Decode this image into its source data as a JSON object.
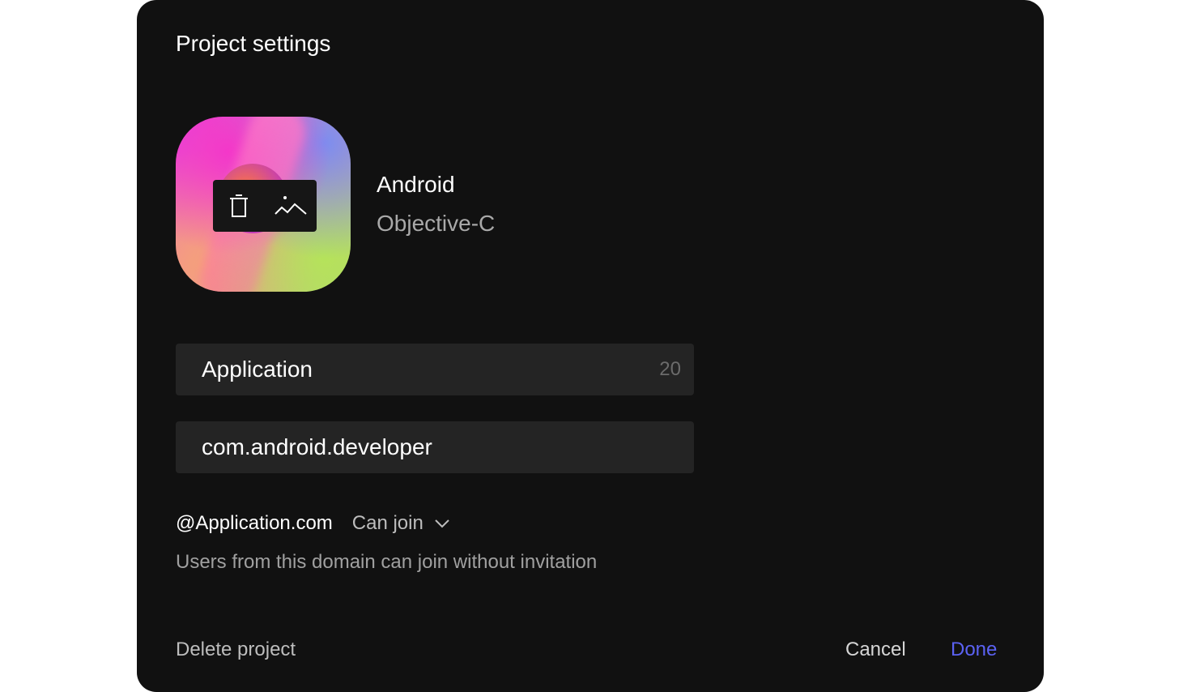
{
  "dialog": {
    "title": "Project settings"
  },
  "project": {
    "name": "Android",
    "language": "Objective-C"
  },
  "avatar_toolbar": {
    "delete_icon": "trash-icon",
    "change_icon": "image-icon"
  },
  "fields": {
    "name_value": "Application",
    "name_counter": "20",
    "package_value": "com.android.developer"
  },
  "domain": {
    "address": "@Application.com",
    "access_selected": "Can join",
    "hint": "Users from this domain can join without invitation"
  },
  "footer": {
    "delete_label": "Delete project",
    "cancel_label": "Cancel",
    "done_label": "Done"
  },
  "colors": {
    "background": "#111111",
    "field": "#242424",
    "accent": "#5b62f3"
  }
}
